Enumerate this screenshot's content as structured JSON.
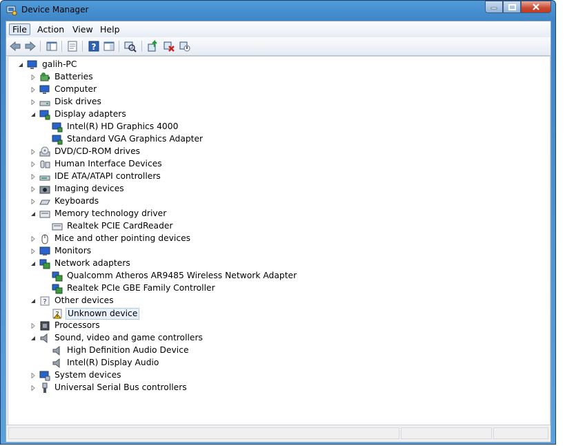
{
  "window": {
    "title": "Device Manager"
  },
  "menu": [
    "File",
    "Action",
    "View",
    "Help"
  ],
  "toolbar": {
    "buttons": [
      {
        "name": "back-icon"
      },
      {
        "name": "forward-icon"
      },
      {
        "name": "show-hide-console-tree-icon"
      },
      {
        "name": "properties-icon"
      },
      {
        "name": "help-icon"
      },
      {
        "name": "show-action-pane-icon"
      },
      {
        "name": "scan-hardware-changes-icon"
      },
      {
        "name": "update-driver-icon"
      },
      {
        "name": "uninstall-icon"
      },
      {
        "name": "disable-icon"
      }
    ]
  },
  "tree": {
    "root": "galih-PC",
    "categories": [
      {
        "label": "Batteries",
        "icon": "battery-icon",
        "expanded": false
      },
      {
        "label": "Computer",
        "icon": "computer-icon",
        "expanded": false
      },
      {
        "label": "Disk drives",
        "icon": "disk-drive-icon",
        "expanded": false
      },
      {
        "label": "Display adapters",
        "icon": "display-adapter-icon",
        "expanded": true,
        "children": [
          "Intel(R) HD Graphics 4000",
          "Standard VGA Graphics Adapter"
        ]
      },
      {
        "label": "DVD/CD-ROM drives",
        "icon": "dvd-drive-icon",
        "expanded": false
      },
      {
        "label": "Human Interface Devices",
        "icon": "hid-icon",
        "expanded": false
      },
      {
        "label": "IDE ATA/ATAPI controllers",
        "icon": "ide-controller-icon",
        "expanded": false
      },
      {
        "label": "Imaging devices",
        "icon": "camera-icon",
        "expanded": false
      },
      {
        "label": "Keyboards",
        "icon": "keyboard-icon",
        "expanded": false
      },
      {
        "label": "Memory technology driver",
        "icon": "memory-card-icon",
        "expanded": true,
        "children": [
          "Realtek PCIE CardReader"
        ]
      },
      {
        "label": "Mice and other pointing devices",
        "icon": "mouse-icon",
        "expanded": false
      },
      {
        "label": "Monitors",
        "icon": "monitor-icon",
        "expanded": false
      },
      {
        "label": "Network adapters",
        "icon": "network-adapter-icon",
        "expanded": true,
        "children": [
          "Qualcomm Atheros AR9485 Wireless Network Adapter",
          "Realtek PCIe GBE Family Controller"
        ]
      },
      {
        "label": "Other devices",
        "icon": "unknown-device-icon",
        "expanded": true,
        "children": [
          "Unknown device"
        ]
      },
      {
        "label": "Processors",
        "icon": "processor-icon",
        "expanded": false
      },
      {
        "label": "Sound, video and game controllers",
        "icon": "speaker-icon",
        "expanded": true,
        "children": [
          "High Definition Audio Device",
          "Intel(R) Display Audio"
        ]
      },
      {
        "label": "System devices",
        "icon": "system-device-icon",
        "expanded": false
      },
      {
        "label": "Universal Serial Bus controllers",
        "icon": "usb-icon",
        "expanded": false
      }
    ],
    "selected": "Unknown device"
  },
  "colors": {
    "title_bar": "#3f86c7",
    "selection": "#e8f1fb",
    "close_button": "#c74a32"
  }
}
